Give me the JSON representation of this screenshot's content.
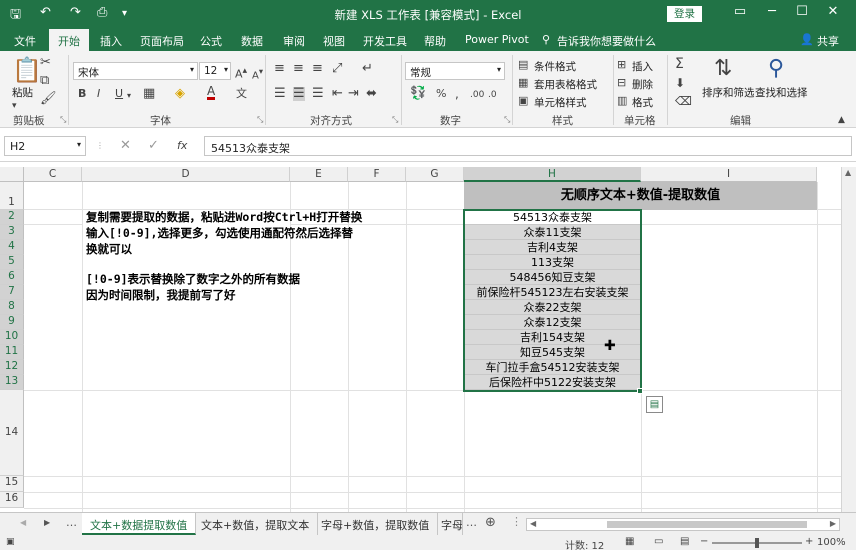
{
  "window": {
    "title": "新建 XLS 工作表 [兼容模式] - Excel",
    "login": "登录"
  },
  "tabs": [
    "文件",
    "开始",
    "插入",
    "页面布局",
    "公式",
    "数据",
    "审阅",
    "视图",
    "开发工具",
    "帮助",
    "Power Pivot"
  ],
  "tell_me": "告诉我你想要做什么",
  "share": "共享",
  "ribbon": {
    "paste": "粘贴",
    "clipboard": "剪贴板",
    "font_name": "宋体",
    "font_size": "12",
    "font_group": "字体",
    "align_group": "对齐方式",
    "number_format": "常规",
    "number_group": "数字",
    "cond_format": "条件格式",
    "table_format": "套用表格格式",
    "cell_style": "单元格样式",
    "style_group": "样式",
    "insert": "插入",
    "delete": "删除",
    "format": "格式",
    "cells_group": "单元格",
    "sort_filter": "排序和筛选",
    "find_select": "查找和选择",
    "edit_group": "编辑"
  },
  "formula": {
    "namebox": "H2",
    "value": "54513众泰支架"
  },
  "columns": [
    "C",
    "D",
    "E",
    "F",
    "G",
    "H",
    "I"
  ],
  "rows": [
    "1",
    "2",
    "3",
    "4",
    "5",
    "6",
    "7",
    "8",
    "9",
    "10",
    "11",
    "12",
    "13",
    "14",
    "15",
    "16"
  ],
  "header_H": "无顺序文本+数值-提取数值",
  "cells_H": [
    "54513众泰支架",
    "众泰11支架",
    "吉利4支架",
    "113支架",
    "548456知豆支架",
    "前保险杆545123左右安装支架",
    "众泰22支架",
    "众泰12支架",
    "吉利154支架",
    "知豆545支架",
    "车门拉手盒54512安装支架",
    "后保险杆中5122安装支架"
  ],
  "notes": [
    "复制需要提取的数据，粘贴进Word按Ctrl+H打开替换",
    "输入[!0-9],选择更多，勾选使用通配符然后选择替",
    "换就可以",
    "[!0-9]表示替换除了数字之外的所有数据",
    "因为时间限制，我提前写了好"
  ],
  "sheets": [
    "文本+数据提取数值",
    "文本+数值，提取文本",
    "字母+数值，提取数值",
    "字母"
  ],
  "status": {
    "count": "计数: 12",
    "zoom": "100%"
  }
}
